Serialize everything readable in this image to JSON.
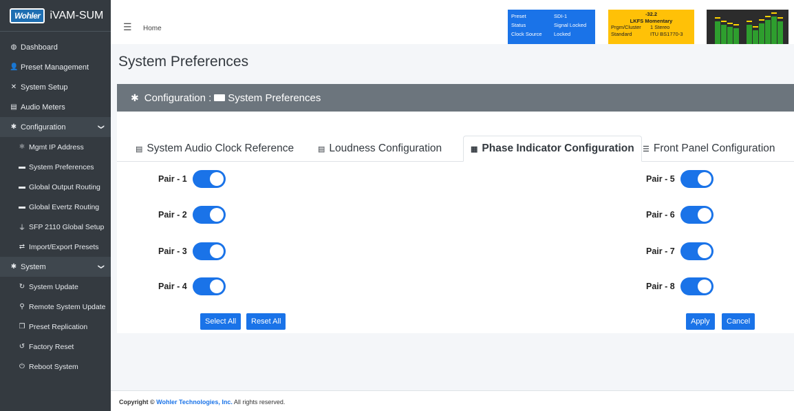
{
  "brand": {
    "logo": "Wohler",
    "name": "iVAM-SUM"
  },
  "sidebar": {
    "items": [
      {
        "label": "Dashboard",
        "icon": "tachometer-icon",
        "glyph": "◍"
      },
      {
        "label": "Preset Management",
        "icon": "user-edit-icon",
        "glyph": "👤"
      },
      {
        "label": "System Setup",
        "icon": "tools-icon",
        "glyph": "✕"
      },
      {
        "label": "Audio Meters",
        "icon": "chart-icon",
        "glyph": "▤"
      },
      {
        "label": "Configuration",
        "icon": "gear-icon",
        "glyph": "✱",
        "section": true
      },
      {
        "label": "Mgmt IP Address",
        "icon": "network-icon",
        "glyph": "⚛",
        "sub": true
      },
      {
        "label": "System Preferences",
        "icon": "id-card-icon",
        "glyph": "▬",
        "sub": true
      },
      {
        "label": "Global Output Routing",
        "icon": "id-card-icon",
        "glyph": "▬",
        "sub": true
      },
      {
        "label": "Global Evertz Routing",
        "icon": "id-card-icon",
        "glyph": "▬",
        "sub": true
      },
      {
        "label": "SFP 2110 Global Setup",
        "icon": "plug-icon",
        "glyph": "⏚",
        "sub": true
      },
      {
        "label": "Import/Export Presets",
        "icon": "exchange-icon",
        "glyph": "⇄",
        "sub": true
      },
      {
        "label": "System",
        "icon": "gears-icon",
        "glyph": "✱",
        "section": true
      },
      {
        "label": "System Update",
        "icon": "sync-icon",
        "glyph": "↻",
        "sub": true
      },
      {
        "label": "Remote System Update",
        "icon": "network-wired-icon",
        "glyph": "⚲",
        "sub": true
      },
      {
        "label": "Preset Replication",
        "icon": "copy-icon",
        "glyph": "❐",
        "sub": true
      },
      {
        "label": "Factory Reset",
        "icon": "undo-icon",
        "glyph": "↺",
        "sub": true
      },
      {
        "label": "Reboot System",
        "icon": "power-icon",
        "glyph": "⏻",
        "sub": true
      }
    ]
  },
  "topbar": {
    "home": "Home",
    "status": {
      "preset_label": "Preset",
      "preset_value": "SDI-1",
      "status_label": "Status",
      "status_value": "Signal Locked",
      "clock_label": "Clock Source",
      "clock_value": "Locked"
    },
    "loudness": {
      "value": "-32.2",
      "title": "LKFS  Momentary",
      "cluster_label": "Prgm/Cluster",
      "cluster_value": "1  Stereo",
      "standard_label": "Standard",
      "standard_value": "ITU BS1770-3"
    },
    "meter_levels": [
      0.65,
      0.55,
      0.5,
      0.45,
      0.55,
      0.4,
      0.6,
      0.7,
      0.8,
      0.65
    ]
  },
  "page_title": "System Preferences",
  "card": {
    "header_prefix": "Configuration : ",
    "header_title": "System Preferences"
  },
  "tabs": [
    {
      "label": "System Audio Clock Reference",
      "icon": "chart-icon",
      "glyph": "▤"
    },
    {
      "label": "Loudness Configuration",
      "icon": "chart-icon",
      "glyph": "▤"
    },
    {
      "label": "Phase Indicator Configuration",
      "icon": "grid-icon",
      "glyph": "▦",
      "active": true
    },
    {
      "label": "Front Panel Configuration",
      "icon": "list-icon",
      "glyph": "☰"
    }
  ],
  "pairs_left": [
    {
      "label": "Pair - 1",
      "on": true
    },
    {
      "label": "Pair - 2",
      "on": true
    },
    {
      "label": "Pair - 3",
      "on": true
    },
    {
      "label": "Pair - 4",
      "on": true
    }
  ],
  "pairs_right": [
    {
      "label": "Pair - 5",
      "on": true
    },
    {
      "label": "Pair - 6",
      "on": true
    },
    {
      "label": "Pair - 7",
      "on": true
    },
    {
      "label": "Pair - 8",
      "on": true
    }
  ],
  "buttons": {
    "select_all": "Select All",
    "reset_all": "Reset All",
    "apply": "Apply",
    "cancel": "Cancel"
  },
  "footer": {
    "prefix": "Copyright ©",
    "company": "Wohler Technologies, Inc.",
    "suffix": "All rights reserved."
  },
  "colors": {
    "accent": "#1a73e8",
    "sidebar": "#343a40",
    "header": "#6c757d",
    "loudness": "#ffc107"
  }
}
